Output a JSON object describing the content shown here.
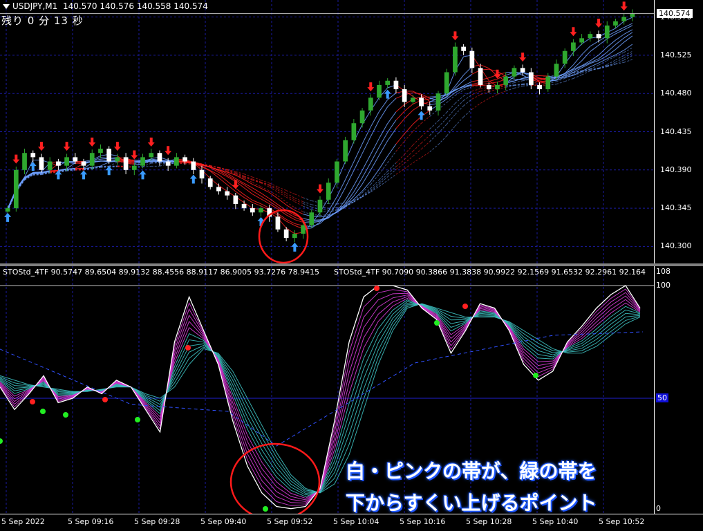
{
  "header": {
    "symbol": "USDJPY,M1",
    "ohlc": "140.570 140.576 140.558 140.574",
    "countdown": "残り 0 分 13 秒"
  },
  "price_axis": {
    "ticks": [
      "140.570",
      "140.525",
      "140.480",
      "140.435",
      "140.390",
      "140.345",
      "140.300"
    ],
    "current_price": "140.574"
  },
  "indicator": {
    "label_left": "STOStd_4TF 90.5747 89.6504 89.9132 88.4556 88.9117 86.9005 93.7276 78.9415",
    "label_right": "STOStd_4TF 90.7090 90.3866 91.3838 90.9922 92.1569 91.6532 92.2961 92.164",
    "axis_max": "108",
    "axis_top_level": "100",
    "axis_mid_level": "50",
    "axis_bottom": "0"
  },
  "time_axis": {
    "labels": [
      "5 Sep 2022",
      "5 Sep 09:16",
      "5 Sep 09:28",
      "5 Sep 09:40",
      "5 Sep 09:52",
      "5 Sep 10:04",
      "5 Sep 10:16",
      "5 Sep 10:28",
      "5 Sep 10:40",
      "5 Sep 10:52"
    ]
  },
  "annotation": {
    "line1": "白・ピンクの帯が、緑の帯を",
    "line2": "下からすくい上げるポイント"
  },
  "colors": {
    "bull_candle": "#2fa82f",
    "bear_candle": "#ffffff",
    "grid": "#1a1aa0",
    "ma_red": "#ff2020",
    "ma_blue": "#6fa0ff",
    "sto_white": "#ffffff",
    "sto_magenta": "#e040e0",
    "sto_teal": "#40c8c8",
    "signal_green": "#22ee22",
    "signal_red": "#ff2020",
    "circle": "#ff1a1a"
  },
  "chart_data": [
    {
      "type": "candlestick",
      "title": "USDJPY,M1",
      "ylim": [
        140.28,
        140.59
      ],
      "close": [
        140.345,
        140.39,
        140.41,
        140.405,
        140.39,
        140.4,
        140.395,
        140.405,
        140.4,
        140.395,
        140.41,
        140.415,
        140.4,
        140.405,
        140.39,
        140.395,
        140.405,
        140.41,
        140.4,
        140.395,
        140.405,
        140.4,
        140.39,
        140.38,
        140.37,
        140.365,
        140.36,
        140.35,
        140.345,
        140.34,
        140.345,
        140.335,
        140.32,
        140.31,
        140.315,
        140.325,
        140.34,
        140.355,
        140.375,
        140.4,
        140.425,
        140.445,
        140.46,
        140.475,
        140.49,
        140.495,
        140.485,
        140.47,
        140.475,
        140.465,
        140.46,
        140.48,
        140.505,
        140.535,
        140.53,
        140.51,
        140.49,
        140.485,
        140.49,
        140.5,
        140.51,
        140.505,
        140.49,
        140.485,
        140.5,
        140.515,
        140.53,
        140.54,
        140.545,
        140.55,
        140.545,
        140.56,
        140.565,
        140.57,
        140.574
      ],
      "buy_signals": 11,
      "sell_signals": 17,
      "current_price": 140.574
    },
    {
      "type": "line",
      "title": "STOStd_4TF",
      "ylim": [
        0,
        108
      ],
      "levels": [
        100,
        50,
        0
      ],
      "fast": [
        55,
        45,
        52,
        60,
        48,
        50,
        55,
        52,
        58,
        55,
        45,
        35,
        75,
        95,
        80,
        65,
        40,
        20,
        8,
        2,
        1,
        2,
        10,
        40,
        75,
        95,
        100,
        100,
        98,
        90,
        85,
        70,
        80,
        92,
        90,
        80,
        65,
        58,
        62,
        75,
        82,
        90,
        96,
        100,
        90
      ],
      "slow": [
        60,
        58,
        56,
        55,
        54,
        53,
        53,
        54,
        55,
        55,
        52,
        50,
        55,
        65,
        72,
        70,
        62,
        50,
        38,
        26,
        16,
        10,
        8,
        12,
        25,
        45,
        65,
        80,
        90,
        92,
        90,
        88,
        86,
        86,
        86,
        84,
        80,
        76,
        72,
        70,
        70,
        73,
        78,
        83,
        86
      ]
    }
  ]
}
